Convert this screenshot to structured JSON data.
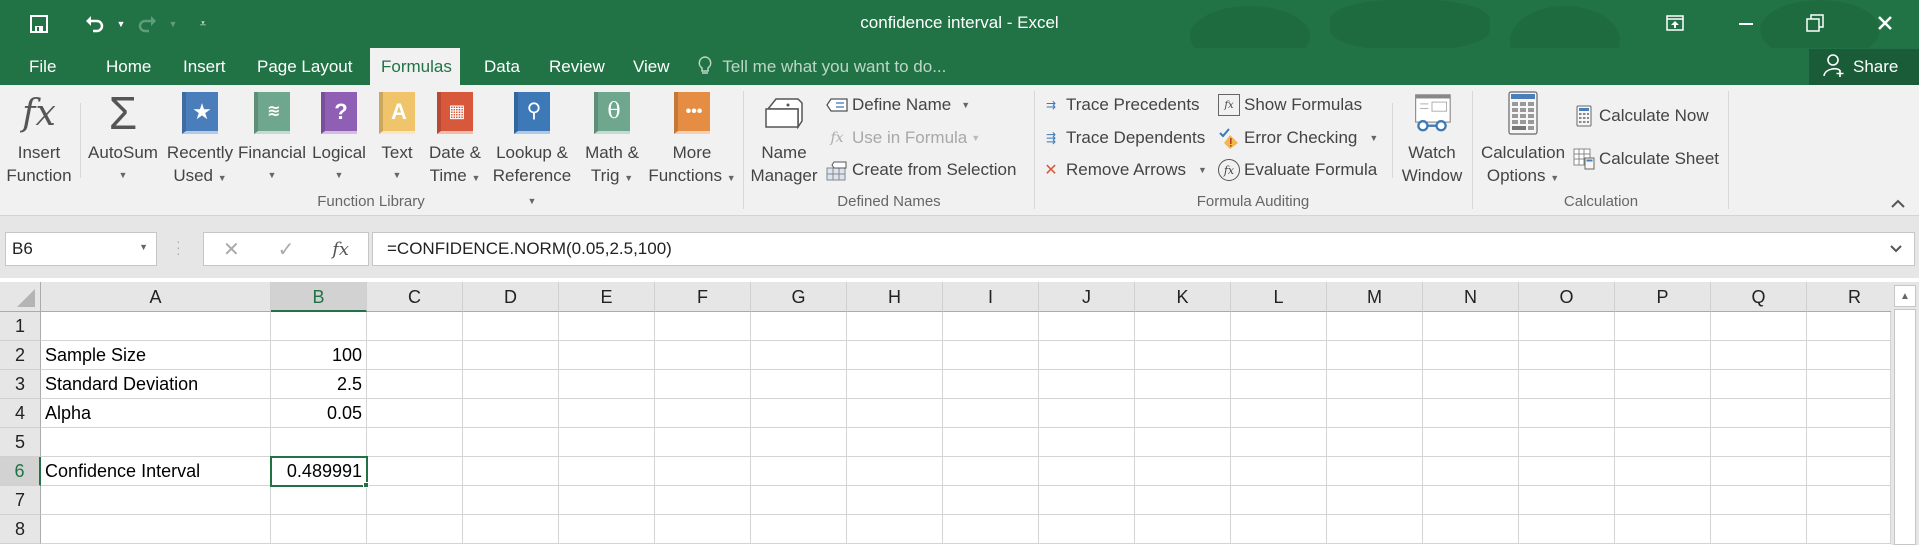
{
  "window": {
    "title": "confidence interval - Excel",
    "controls": [
      "ribbon-display-options",
      "minimize",
      "restore",
      "close"
    ]
  },
  "quick_access": {
    "save": "save-icon",
    "undo": "undo-icon",
    "redo": "redo-icon",
    "customize": "customize-qat-icon"
  },
  "tabs": [
    {
      "label": "File"
    },
    {
      "label": "Home"
    },
    {
      "label": "Insert"
    },
    {
      "label": "Page Layout"
    },
    {
      "label": "Formulas",
      "active": true
    },
    {
      "label": "Data"
    },
    {
      "label": "Review"
    },
    {
      "label": "View"
    }
  ],
  "tell_me": {
    "placeholder": "Tell me what you want to do..."
  },
  "share": {
    "label": "Share"
  },
  "ribbon": {
    "function_library": {
      "label": "Function Library",
      "insert_function": {
        "line1": "Insert",
        "line2": "Function"
      },
      "autosum": {
        "line1": "AutoSum"
      },
      "recently_used": {
        "line1": "Recently",
        "line2": "Used"
      },
      "financial": {
        "line1": "Financial"
      },
      "logical": {
        "line1": "Logical"
      },
      "text": {
        "line1": "Text"
      },
      "date_time": {
        "line1": "Date &",
        "line2": "Time"
      },
      "lookup": {
        "line1": "Lookup &",
        "line2": "Reference"
      },
      "math": {
        "line1": "Math &",
        "line2": "Trig"
      },
      "more": {
        "line1": "More",
        "line2": "Functions"
      }
    },
    "defined_names": {
      "label": "Defined Names",
      "name_manager": {
        "line1": "Name",
        "line2": "Manager"
      },
      "define_name": "Define Name",
      "use_in_formula": "Use in Formula",
      "create_from_selection": "Create from Selection"
    },
    "formula_auditing": {
      "label": "Formula Auditing",
      "trace_precedents": "Trace Precedents",
      "trace_dependents": "Trace Dependents",
      "remove_arrows": "Remove Arrows",
      "show_formulas": "Show Formulas",
      "error_checking": "Error Checking",
      "evaluate_formula": "Evaluate Formula",
      "watch_window": {
        "line1": "Watch",
        "line2": "Window"
      }
    },
    "calculation": {
      "label": "Calculation",
      "calculation_options": {
        "line1": "Calculation",
        "line2": "Options"
      },
      "calculate_now": "Calculate Now",
      "calculate_sheet": "Calculate Sheet"
    }
  },
  "formula_bar": {
    "name_box": "B6",
    "formula": "=CONFIDENCE.NORM(0.05,2.5,100)"
  },
  "sheet": {
    "columns": [
      "A",
      "B",
      "C",
      "D",
      "E",
      "F",
      "G",
      "H",
      "I",
      "J",
      "K",
      "L",
      "M",
      "N",
      "O",
      "P",
      "Q",
      "R"
    ],
    "selected_column": "B",
    "rows": [
      "1",
      "2",
      "3",
      "4",
      "5",
      "6",
      "7",
      "8"
    ],
    "selected_row": "6",
    "active_cell": "B6",
    "cells": {
      "A2": "Sample Size",
      "B2": "100",
      "A3": "Standard Deviation",
      "B3": "2.5",
      "A4": "Alpha",
      "B4": "0.05",
      "A6": "Confidence Interval",
      "B6": "0.489991"
    }
  },
  "colors": {
    "accent": "#217346",
    "recently_used": "#4a7ebb",
    "financial": "#6fa78e",
    "logical": "#8e5fb5",
    "text": "#f0c46a",
    "date_time": "#d8583b",
    "lookup": "#3d78b7",
    "math": "#6fa78e",
    "more": "#e58d42"
  }
}
